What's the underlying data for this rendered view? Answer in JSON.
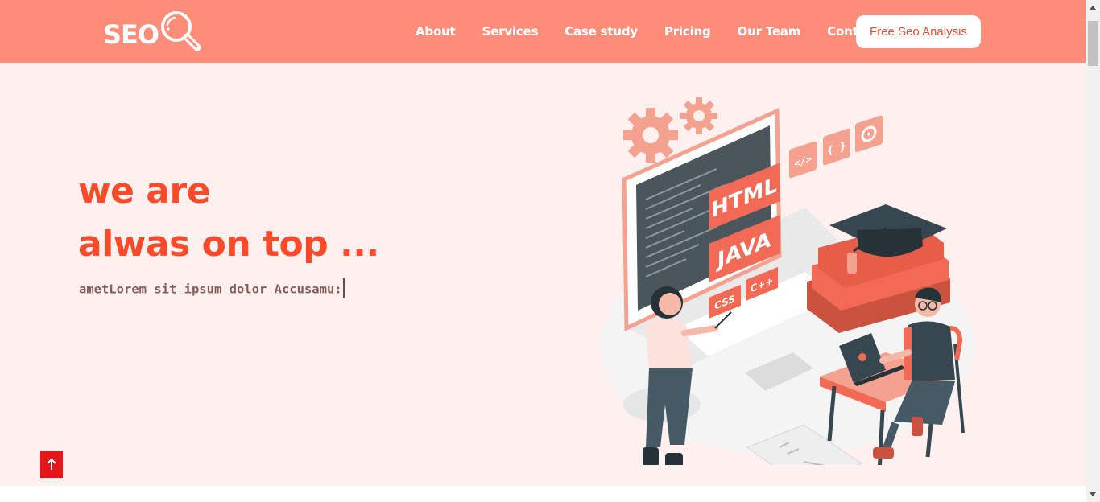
{
  "brand": {
    "logo_text": "SEO"
  },
  "nav": {
    "links": [
      "About",
      "Services",
      "Case study",
      "Pricing",
      "Our Team",
      "Contact"
    ],
    "cta_label": "Free Seo Analysis"
  },
  "hero": {
    "headline_line1": "we are",
    "headline_line2": "alwas on top ...",
    "subtitle": "ametLorem sit ipsum dolor Accusamu:"
  },
  "illustration": {
    "board_labels": [
      "HTML",
      "JAVA",
      "CSS",
      "C++"
    ],
    "code_icons": [
      "</>",
      "{ }"
    ]
  },
  "colors": {
    "navbar": "#fd8c78",
    "hero_background": "#fff0f0",
    "headline": "#fb4a2a",
    "cta_text": "#f04a2e",
    "back_to_top": "#e8141c"
  },
  "icons": {
    "logo": "magnifier-icon",
    "back_to_top": "arrow-up-icon"
  }
}
